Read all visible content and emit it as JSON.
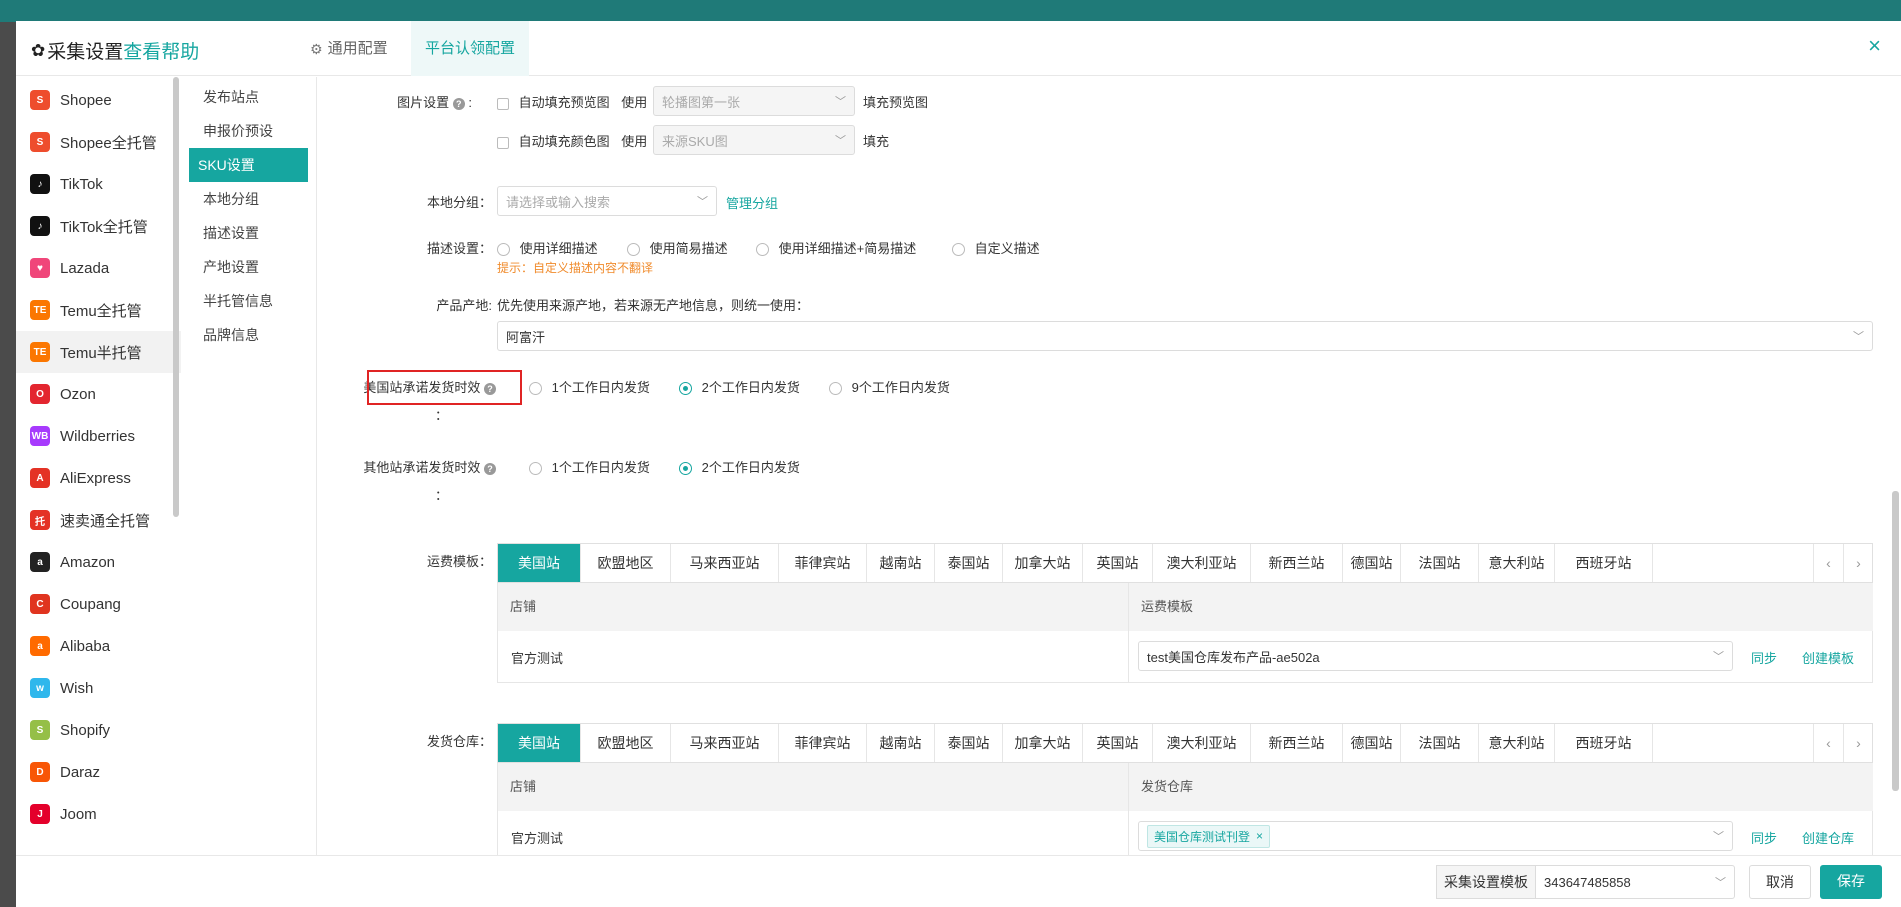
{
  "header": {
    "title": "采集设置",
    "help": "查看帮助",
    "tabs": [
      {
        "label": "通用配置",
        "icon": "gear-icon"
      },
      {
        "label": "平台认领配置",
        "icon": ""
      }
    ],
    "close": "×"
  },
  "platforms": [
    {
      "label": "Shopee",
      "icon_text": "S",
      "color": "#ee4d2d"
    },
    {
      "label": "Shopee全托管",
      "icon_text": "S",
      "color": "#ee4d2d"
    },
    {
      "label": "TikTok",
      "icon_text": "♪",
      "color": "#111111"
    },
    {
      "label": "TikTok全托管",
      "icon_text": "♪",
      "color": "#111111"
    },
    {
      "label": "Lazada",
      "icon_text": "♥",
      "color": "#f0467a"
    },
    {
      "label": "Temu全托管",
      "icon_text": "TE",
      "color": "#fb7701"
    },
    {
      "label": "Temu半托管",
      "icon_text": "TE",
      "color": "#fb7701"
    },
    {
      "label": "Ozon",
      "icon_text": "O",
      "color": "#e3262f"
    },
    {
      "label": "Wildberries",
      "icon_text": "WB",
      "color": "#a73afd"
    },
    {
      "label": "AliExpress",
      "icon_text": "A",
      "color": "#e43225"
    },
    {
      "label": "速卖通全托管",
      "icon_text": "托",
      "color": "#e43225"
    },
    {
      "label": "Amazon",
      "icon_text": "a",
      "color": "#222222"
    },
    {
      "label": "Coupang",
      "icon_text": "C",
      "color": "#e0341f"
    },
    {
      "label": "Alibaba",
      "icon_text": "a",
      "color": "#ff6a00"
    },
    {
      "label": "Wish",
      "icon_text": "w",
      "color": "#2fb7ec"
    },
    {
      "label": "Shopify",
      "icon_text": "S",
      "color": "#95bf47"
    },
    {
      "label": "Daraz",
      "icon_text": "D",
      "color": "#f85606"
    },
    {
      "label": "Joom",
      "icon_text": "J",
      "color": "#e4002b"
    }
  ],
  "subnav": [
    "发布站点",
    "申报价预设",
    "SKU设置",
    "本地分组",
    "描述设置",
    "产地设置",
    "半托管信息",
    "品牌信息"
  ],
  "image_settings": {
    "label": "图片设置",
    "row1": {
      "checkbox": "自动填充预览图",
      "use": "使用",
      "select": "轮播图第一张",
      "suffix": "填充预览图"
    },
    "row2": {
      "checkbox": "自动填充颜色图",
      "use": "使用",
      "select": "来源SKU图",
      "suffix": "填充"
    }
  },
  "local_group": {
    "label": "本地分组：",
    "placeholder": "请选择或输入搜索",
    "manage": "管理分组"
  },
  "desc_settings": {
    "label": "描述设置：",
    "options": [
      "使用详细描述",
      "使用简易描述",
      "使用详细描述+简易描述",
      "自定义描述"
    ],
    "hint": "提示：自定义描述内容不翻译"
  },
  "origin": {
    "label": "产品产地:",
    "text": "优先使用来源产地，若来源无产地信息，则统一使用：",
    "value": "阿富汗"
  },
  "us_ship": {
    "label": "美国站承诺发货时效",
    "colon": "：",
    "options": [
      "1个工作日内发货",
      "2个工作日内发货",
      "9个工作日内发货"
    ],
    "selected": 1
  },
  "other_ship": {
    "label": "其他站承诺发货时效",
    "colon": "：",
    "options": [
      "1个工作日内发货",
      "2个工作日内发货"
    ],
    "selected": 1
  },
  "site_tabs": [
    "美国站",
    "欧盟地区",
    "马来西亚站",
    "菲律宾站",
    "越南站",
    "泰国站",
    "加拿大站",
    "英国站",
    "澳大利亚站",
    "新西兰站",
    "德国站",
    "法国站",
    "意大利站",
    "西班牙站"
  ],
  "freight": {
    "label": "运费模板：",
    "col1": "店铺",
    "col2": "运费模板",
    "store": "官方测试",
    "template": "test美国仓库发布产品-ae502a",
    "sync": "同步",
    "create": "创建模板"
  },
  "warehouse": {
    "label": "发货仓库：",
    "col1": "店铺",
    "col2": "发货仓库",
    "store": "官方测试",
    "tag": "美国仓库测试刊登",
    "sync": "同步",
    "create": "创建仓库"
  },
  "footer": {
    "template_label": "采集设置模板",
    "template_value": "343647485858",
    "cancel": "取消",
    "save": "保存"
  }
}
